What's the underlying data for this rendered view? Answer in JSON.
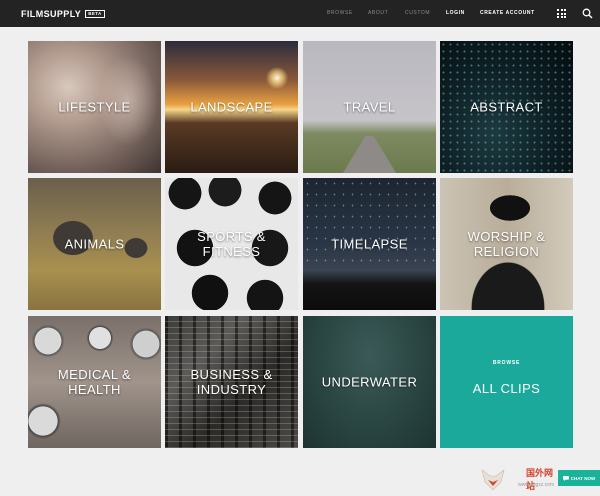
{
  "header": {
    "logo": "FILMSUPPLY",
    "beta": "BETA",
    "nav": [
      {
        "label": "BROWSE"
      },
      {
        "label": "ABOUT"
      },
      {
        "label": "CUSTOM"
      },
      {
        "label": "LOGIN"
      },
      {
        "label": "CREATE ACCOUNT"
      }
    ],
    "icons": [
      "grid-icon",
      "search-icon"
    ]
  },
  "categories": [
    {
      "label": "LIFESTYLE"
    },
    {
      "label": "LANDSCAPE"
    },
    {
      "label": "TRAVEL"
    },
    {
      "label": "ABSTRACT"
    },
    {
      "label": "ANIMALS"
    },
    {
      "label": "SPORTS &\nFITNESS"
    },
    {
      "label": "TIMELAPSE"
    },
    {
      "label": "WORSHIP &\nRELIGION"
    },
    {
      "label": "MEDICAL &\nHEALTH"
    },
    {
      "label": "BUSINESS &\nINDUSTRY"
    },
    {
      "label": "UNDERWATER"
    },
    {
      "label": "ALL CLIPS",
      "sublabel": "BROWSE",
      "color": "#1aa99a"
    }
  ],
  "chat": {
    "label": "CHAT NOW"
  },
  "watermark": {
    "cn": "国外网站",
    "url": "www.eggxz.com"
  }
}
